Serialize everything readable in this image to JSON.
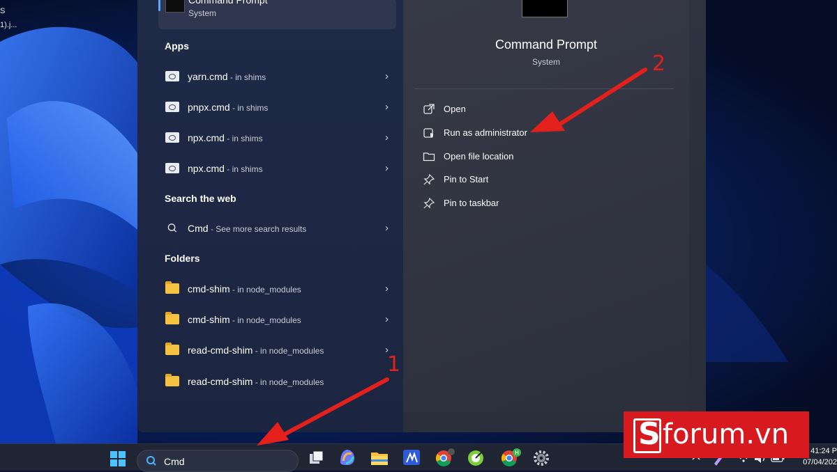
{
  "desktop": {
    "fragment_1": "S",
    "fragment_2": "1).j..."
  },
  "start_menu": {
    "best_match": {
      "title": "Command Prompt",
      "subtitle": "System"
    },
    "apps_title": "Apps",
    "apps": [
      {
        "name": "yarn.cmd",
        "location": " - in shims"
      },
      {
        "name": "pnpx.cmd",
        "location": " - in shims"
      },
      {
        "name": "npx.cmd",
        "location": " - in shims"
      },
      {
        "name": "npx.cmd",
        "location": " - in shims"
      }
    ],
    "web_title": "Search the web",
    "web": {
      "name": "Cmd",
      "location": " - See more search results"
    },
    "folders_title": "Folders",
    "folders": [
      {
        "name": "cmd-shim",
        "location": " - in node_modules"
      },
      {
        "name": "cmd-shim",
        "location": " - in node_modules"
      },
      {
        "name": "read-cmd-shim",
        "location": " - in node_modules"
      },
      {
        "name": "read-cmd-shim",
        "location": " - in node_modules"
      }
    ],
    "detail": {
      "title": "Command Prompt",
      "subtitle": "System",
      "actions": [
        {
          "label": "Open",
          "icon": "open-external-icon"
        },
        {
          "label": "Run as administrator",
          "icon": "shield-admin-icon"
        },
        {
          "label": "Open file location",
          "icon": "folder-icon"
        },
        {
          "label": "Pin to Start",
          "icon": "pin-icon"
        },
        {
          "label": "Pin to taskbar",
          "icon": "pin-icon"
        }
      ]
    }
  },
  "taskbar": {
    "search_value": "Cmd",
    "clock_time": "41:24 P",
    "clock_date": "07/04/202",
    "pinned": [
      "windows-start-icon",
      "task-view-icon",
      "copilot-icon",
      "file-explorer-icon",
      "app-icon",
      "chrome-icon",
      "coccoc-icon",
      "chrome-profile-icon",
      "settings-icon"
    ],
    "tray_badge": "H"
  },
  "logo": {
    "mark": "S",
    "text": "forum.vn"
  },
  "annotations": {
    "label_1": "1",
    "label_2": "2",
    "color": "#e3201b"
  }
}
